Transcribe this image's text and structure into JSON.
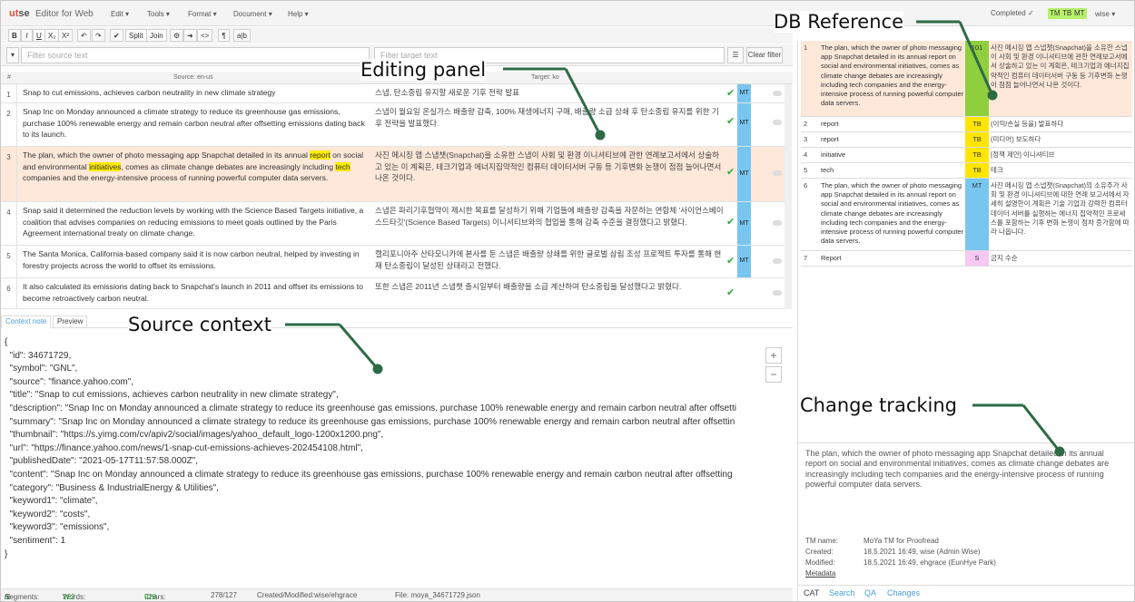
{
  "app": {
    "logo_a": "ut",
    "logo_b": "se",
    "title": "Editor for Web"
  },
  "menu": [
    "Edit",
    "Tools",
    "Format",
    "Document",
    "Help"
  ],
  "header_right": {
    "status": "Completed ✓",
    "tags": [
      "TM",
      "TB",
      "MT"
    ],
    "user": "wise"
  },
  "toolbar": [
    "B",
    "I",
    "U",
    "X₂",
    "X²",
    "↶",
    "↷",
    "✔",
    "Split",
    "Join",
    "⚙",
    "➜",
    "<>",
    "¶",
    "a|b"
  ],
  "filters": {
    "source_placeholder": "Filter source text",
    "target_placeholder": "Filter target text",
    "clear_label": "Clear filter"
  },
  "columns": {
    "num": "#",
    "source": "Source: en-us",
    "target": "Target: ko"
  },
  "segments": [
    {
      "n": "1",
      "source": "Snap to cut emissions, achieves carbon neutrality in new climate strategy",
      "target": "스냅, 탄소중립 유지할 새로운 기후 전략 발표",
      "mt": "MT"
    },
    {
      "n": "2",
      "source": "Snap Inc on Monday announced a climate strategy to reduce its greenhouse gas emissions, purchase 100% renewable energy and remain carbon neutral after offsetting emissions dating back to its launch.",
      "target": "스냅이 월요일 온실가스 배출량 감축, 100% 재생에너지 구매, 배출량 소급 상쇄 후 탄소중립 유지를 위한 기후 전략을 발표했다.",
      "mt": "MT"
    },
    {
      "n": "3",
      "source_parts": [
        "The plan, which the owner of photo messaging app Snapchat detailed in its annual ",
        "report",
        " on social and environmental ",
        "initiatives",
        ", comes as climate change debates are increasingly including ",
        "tech",
        " companies and the energy-intensive process of running powerful computer data servers."
      ],
      "target": "사진 메시징 앱 스냅챗(Snapchat)을 소유한 스냅이 사회 및 환경 이니셔티브에 관한 연례보고서에서 상술하고 있는 이 계획은, 테크기업과 에너지집약적인 컴퓨터 데이터서버 구동 등 기후변화 논쟁이 점점 늘어나면서 나온 것이다.",
      "mt": "MT"
    },
    {
      "n": "4",
      "source": "Snap said it determined the reduction levels by working with the Science Based Targets initiative, a coalition that advises companies on reducing emissions to meet goals outlined by the Paris Agreement international treaty on climate change.",
      "target": "스냅은 파리기후협약이 제시한 목표를 달성하기 위해 기업들에 배출량 감축을 자문하는 연합체 '사이언스베이스드타깃'(Science Based Targets) 이니셔티브와의 협업을 통해 감축 수준을 결정했다고 밝혔다.",
      "mt": "MT"
    },
    {
      "n": "5",
      "source": "The Santa Monica, California-based company said it is now carbon neutral, helped by investing in forestry projects across the world to offset its emissions.",
      "target": "캘리포니아주 산타모니카에 본사를 둔 스냅은 배출량 상쇄를 위한 글로벌 삼림 조성 프로젝트 투자를 통해 현재 탄소중립이 달성된 상태라고 전했다.",
      "mt": "MT"
    },
    {
      "n": "6",
      "source": "It also calculated its emissions dating back to Snapchat's launch in 2011 and offset its emissions to become retroactively carbon neutral.",
      "target": "또한 스냅은 2011년 스냅챗 출시일부터 배출량을 소급 계산하여 탄소중립을 달성했다고 밝혔다.",
      "mt": ""
    }
  ],
  "context_tabs": [
    "Context note",
    "Preview"
  ],
  "context_lines": [
    "{",
    "  \"id\": 34671729,",
    "  \"symbol\": \"GNL\",",
    "  \"source\": \"finance.yahoo.com\",",
    "  \"title\": \"Snap to cut emissions, achieves carbon neutrality in new climate strategy\",",
    "  \"description\": \"Snap Inc on Monday announced a climate strategy to reduce its greenhouse gas emissions, purchase 100% renewable energy and remain carbon neutral after offsetti",
    "  \"summary\": \"Snap Inc on Monday announced a climate strategy to reduce its greenhouse gas emissions, purchase 100% renewable energy and remain carbon neutral after offsettin",
    "  \"thumbnail\": \"https://s.yimg.com/cv/apiv2/social/images/yahoo_default_logo-1200x1200.png\",",
    "  \"url\": \"https://finance.yahoo.com/news/1-snap-cut-emissions-achieves-202454108.html\",",
    "  \"publishedDate\": \"2021-05-17T11:57:58.000Z\",",
    "  \"content\": \"Snap Inc on Monday announced a climate strategy to reduce its greenhouse gas emissions, purchase 100% renewable energy and remain carbon neutral after offsetting",
    "  \"category\": \"Business & IndustrialEnergy & Utilities\",",
    "  \"keyword1\": \"climate\",",
    "  \"keyword2\": \"costs\",",
    "  \"keyword3\": \"emissions\",",
    "  \"sentiment\": 1",
    "}"
  ],
  "footer": {
    "segments_label": "Segments: ",
    "segments_a": "6",
    "segments_b": "/6",
    "words_label": "Words: 162/",
    "words_b": "162",
    "chars_label": "Chars: 928/",
    "chars_b": "928",
    "ratio": "278/127",
    "created": "Created/Modified:wise/ehgrace",
    "file": "File: moya_34671729.json"
  },
  "db": [
    {
      "n": "1",
      "source": "The plan, which the owner of photo messaging app Snapchat detailed in its annual report on social and environmental initiatives, comes as climate change debates are increasingly including tech companies and the energy-intensive process of running powerful computer data servers.",
      "type": "101",
      "color": "#8fcf3e",
      "target": "사진 메시징 앱 스냅챗(Snapchat)을 소유한 스냅이 사회 및 환경 이니셔티브에 관한 연례보고서에서 상술하고 있는 이 계획은, 테크기업과 에너지집약적인 컴퓨터 데이터서버 구동 등 기후변화 논쟁이 점점 늘어나면서 나온 것이다."
    },
    {
      "n": "2",
      "source": "report",
      "type": "TB",
      "color": "#ffe600",
      "target": "(이익/손실 등을) 발표하다"
    },
    {
      "n": "3",
      "source": "report",
      "type": "TB",
      "color": "#ffe600",
      "target": "(미디어) 보도하다"
    },
    {
      "n": "4",
      "source": "initiative",
      "type": "TB",
      "color": "#ffe600",
      "target": "[정책 제안] 이니셔티브"
    },
    {
      "n": "5",
      "source": "tech",
      "type": "TB",
      "color": "#ffe600",
      "target": "테크"
    },
    {
      "n": "6",
      "source": "The plan, which the owner of photo messaging app Snapchat detailed in its annual report on social and environmental initiatives, comes as climate change debates are increasingly including tech companies and the energy-intensive process of running powerful computer data servers.",
      "type": "MT",
      "color": "#78c6f0",
      "target": "사진 메시징 앱 스냅챗(Snapchat)의 소유주가 사회 및 환경 이니셔티브에 대한 연례 보고서에서 자세히 설명한이 계획은 기술 기업과 강력한 컴퓨터 데이터 서버를 실행하는 에너지 집약적인 프로세스를 포함하는 기후 변화 논쟁이 점차 증가함에 따라 나옵니다."
    },
    {
      "n": "7",
      "source": "Report",
      "type": "S",
      "color": "#f6c8f3",
      "target": "금지 수순"
    }
  ],
  "change_text": "The plan, which the owner of photo messaging app Snapchat detailed in its annual report on social and environmental initiatives, comes as climate change debates are increasingly including tech companies and the energy-intensive process of running powerful computer data servers.",
  "meta": [
    {
      "k": "TM name:",
      "v": "MoYa TM for Proofread"
    },
    {
      "k": "Created:",
      "v": "18.5.2021 16:49, wise (Admin Wise)"
    },
    {
      "k": "Modified:",
      "v": "18.5.2021 16:49, ehgrace (EunHye Park)"
    }
  ],
  "metadata_link": "Metadata",
  "bottom_tabs": [
    "CAT",
    "Search",
    "QA",
    "Changes"
  ],
  "callouts": {
    "db": "DB Reference",
    "editing": "Editing panel",
    "source": "Source context",
    "change": "Change tracking"
  }
}
